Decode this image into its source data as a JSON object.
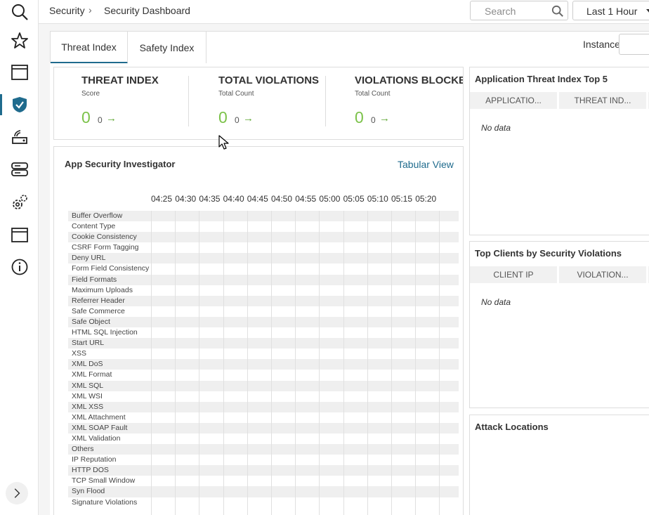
{
  "header": {
    "breadcrumb": [
      "Security",
      "Security Dashboard"
    ],
    "breadcrumb_separator": "›",
    "search_placeholder": "Search",
    "time_range": "Last 1 Hour"
  },
  "tabs": [
    {
      "label": "Threat Index",
      "active": true
    },
    {
      "label": "Safety Index",
      "active": false
    }
  ],
  "instance_label": "Instance",
  "kpis": [
    {
      "title": "THREAT INDEX",
      "subtitle": "Score",
      "value": "0",
      "delta": "0",
      "arrow": "→"
    },
    {
      "title": "TOTAL VIOLATIONS",
      "subtitle": "Total Count",
      "value": "0",
      "delta": "0",
      "arrow": "→"
    },
    {
      "title": "VIOLATIONS BLOCKE",
      "subtitle": "Total Count",
      "value": "0",
      "delta": "0",
      "arrow": "→"
    }
  ],
  "investigator": {
    "title": "App Security Investigator",
    "view_link": "Tabular View",
    "times": [
      "04:25",
      "04:30",
      "04:35",
      "04:40",
      "04:45",
      "04:50",
      "04:55",
      "05:00",
      "05:05",
      "05:10",
      "05:15",
      "05:20"
    ],
    "violations": [
      "Buffer Overflow",
      "Content Type",
      "Cookie Consistency",
      "CSRF Form Tagging",
      "Deny URL",
      "Form Field Consistency",
      "Field Formats",
      "Maximum Uploads",
      "Referrer Header",
      "Safe Commerce",
      "Safe Object",
      "HTML SQL Injection",
      "Start URL",
      "XSS",
      "XML DoS",
      "XML Format",
      "XML SQL",
      "XML WSI",
      "XML XSS",
      "XML Attachment",
      "XML SOAP Fault",
      "XML Validation",
      "Others",
      "IP Reputation",
      "HTTP DOS",
      "TCP Small Window",
      "Syn Flood",
      "Signature Violations"
    ]
  },
  "panels": {
    "top_apps": {
      "title": "Application Threat Index Top 5",
      "columns": [
        "APPLICATIO...",
        "THREAT IND..."
      ],
      "empty": "No data"
    },
    "top_clients": {
      "title": "Top Clients by Security Violations",
      "columns": [
        "CLIENT IP",
        "VIOLATION..."
      ],
      "empty": "No data"
    },
    "attack_locations": {
      "title": "Attack Locations"
    }
  },
  "colors": {
    "accent": "#1f6b8d",
    "value_green": "#7cc24a"
  }
}
